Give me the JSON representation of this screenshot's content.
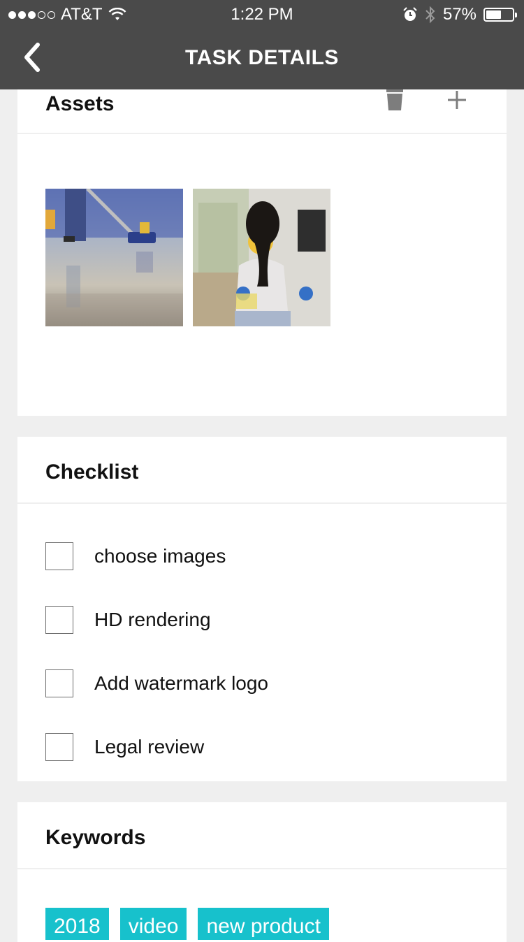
{
  "status_bar": {
    "carrier": "AT&T",
    "signal_bars_filled": 3,
    "signal_bars_total": 5,
    "time": "1:22 PM",
    "battery_text": "57%",
    "battery_level": 0.57
  },
  "nav": {
    "title": "TASK DETAILS",
    "back_icon": "chevron-left-icon"
  },
  "assets": {
    "title": "Assets",
    "delete_icon": "trash-icon",
    "add_icon": "plus-icon",
    "images": [
      "floor-cleaning-photo",
      "woman-cleaning-photo"
    ]
  },
  "checklist": {
    "title": "Checklist",
    "items": [
      {
        "label": "choose images",
        "checked": false
      },
      {
        "label": "HD rendering",
        "checked": false
      },
      {
        "label": "Add watermark logo",
        "checked": false
      },
      {
        "label": "Legal review",
        "checked": false
      }
    ]
  },
  "keywords": {
    "title": "Keywords",
    "tags": [
      "2018",
      "video",
      "new product"
    ]
  },
  "colors": {
    "bar": "#4a4a4a",
    "background": "#efefef",
    "tag": "#17c1cc"
  }
}
